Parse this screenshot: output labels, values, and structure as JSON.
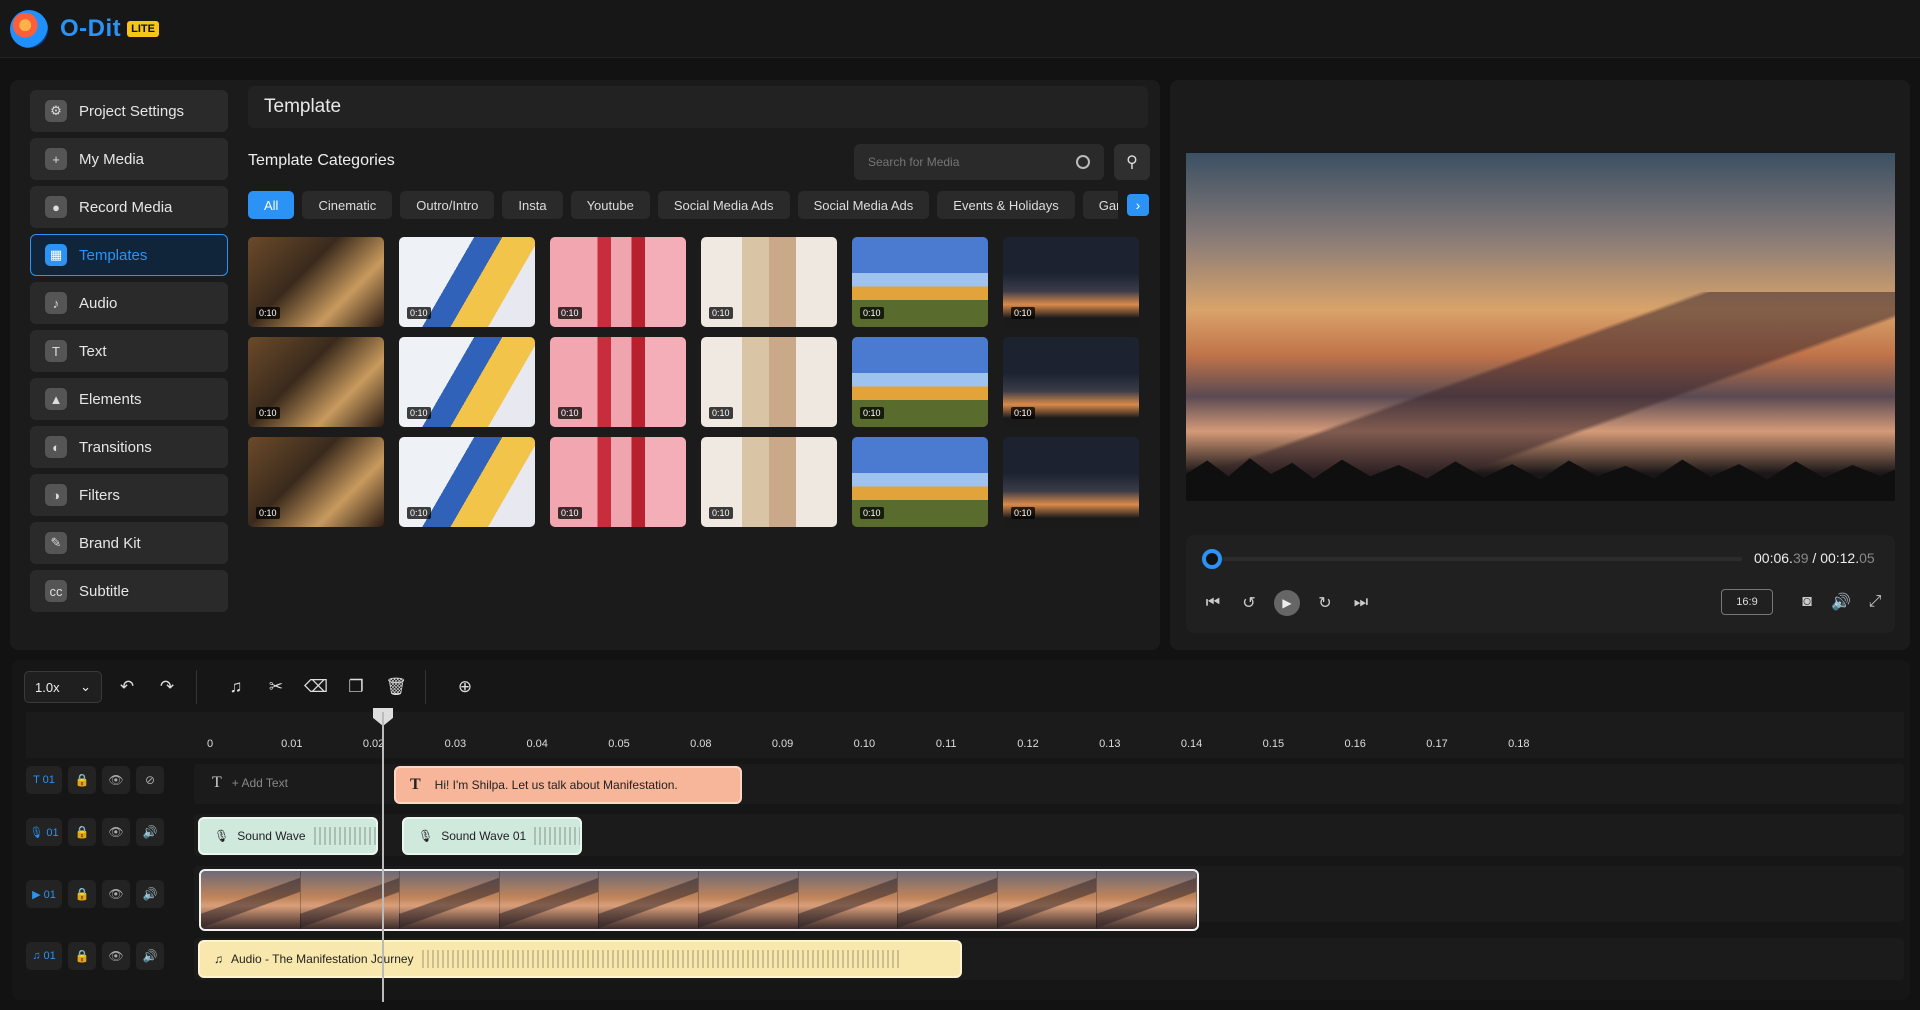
{
  "app": {
    "name": "O-Dit",
    "badge": "LITE"
  },
  "sidebar": {
    "items": [
      {
        "label": "Project Settings",
        "icon": "gear-icon",
        "glyph": "⚙"
      },
      {
        "label": "My Media",
        "icon": "folder-plus-icon",
        "glyph": "+"
      },
      {
        "label": "Record Media",
        "icon": "record-icon",
        "glyph": "●"
      },
      {
        "label": "Templates",
        "icon": "templates-icon",
        "glyph": "▦",
        "active": true
      },
      {
        "label": "Audio",
        "icon": "music-note-icon",
        "glyph": "♪"
      },
      {
        "label": "Text",
        "icon": "text-icon",
        "glyph": "T"
      },
      {
        "label": "Elements",
        "icon": "shapes-icon",
        "glyph": "▲"
      },
      {
        "label": "Transitions",
        "icon": "transitions-icon",
        "glyph": "◐"
      },
      {
        "label": "Filters",
        "icon": "filters-icon",
        "glyph": "◑"
      },
      {
        "label": "Brand Kit",
        "icon": "brand-kit-icon",
        "glyph": "✎"
      },
      {
        "label": "Subtitle",
        "icon": "cc-icon",
        "glyph": "cc"
      }
    ]
  },
  "template_panel": {
    "title": "Template",
    "categories_title": "Template Categories",
    "search": {
      "placeholder": "Search for Media"
    },
    "chips": [
      "All",
      "Cinematic",
      "Outro/Intro",
      "Insta",
      "Youtube",
      "Social Media Ads",
      "Social Media Ads",
      "Events & Holidays",
      "Gaming"
    ],
    "active_chip": "All",
    "thumb_duration": "0:10",
    "grid_rows": 3,
    "grid_cols": 6
  },
  "preview": {
    "current_time_main": "00:06.",
    "current_time_frac": "39",
    "separator": " / ",
    "total_time_main": "00:12.",
    "total_time_frac": "05",
    "aspect_ratio": "16:9",
    "progress": 0.0
  },
  "timeline": {
    "speed": "1.0x",
    "ruler_ticks": [
      "0",
      "0.01",
      "0.02",
      "0.03",
      "0.04",
      "0.05",
      "0.08",
      "0.09",
      "0.10",
      "0.11",
      "0.12",
      "0.13",
      "0.14",
      "0.15",
      "0.16",
      "0.17",
      "0.18"
    ],
    "tracks": {
      "text": {
        "badge": "T 01",
        "add_label": "+ Add Text",
        "clip_label": "Hi! I'm Shilpa. Let us talk about Manifestation."
      },
      "voice": {
        "badge": "🎙 01",
        "clips": [
          "Sound Wave",
          "Sound Wave 01"
        ]
      },
      "video": {
        "badge": "▶ 01"
      },
      "music": {
        "badge": "♫ 01",
        "clip_label": "Audio - The Manifestation Journey"
      }
    }
  },
  "colors": {
    "accent": "#2b93f5",
    "background": "#121212",
    "panel": "#1b1b1b",
    "text_clip": "#f7b59a",
    "sound_clip": "#cfe9dc",
    "audio_clip": "#f9e8ad"
  }
}
